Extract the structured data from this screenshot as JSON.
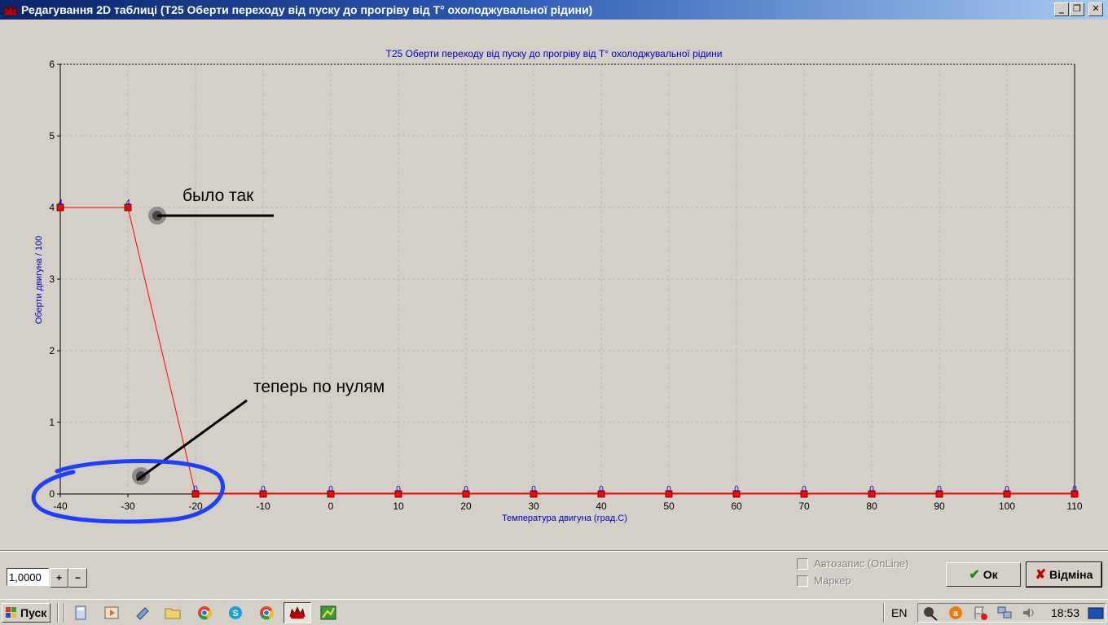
{
  "window": {
    "title": "Редагування 2D таблиці (T25 Оберти переходу від пуску до прогріву від T° охолоджувальної рідини)",
    "minimize_glyph": "_",
    "restore_glyph": "❐",
    "close_glyph": "✕"
  },
  "chart_data": {
    "type": "line",
    "title": "T25 Оберти переходу від пуску до прогріву від T° охолоджувальної рідини",
    "xlabel": "Температура двигуна (град.С)",
    "ylabel": "Оберти двигуна / 100",
    "x": [
      -40,
      -30,
      -20,
      -10,
      0,
      10,
      20,
      30,
      40,
      50,
      60,
      70,
      80,
      90,
      100,
      110
    ],
    "series": [
      {
        "name": "",
        "values": [
          4,
          4,
          0,
          0,
          0,
          0,
          0,
          0,
          0,
          0,
          0,
          0,
          0,
          0,
          0,
          0
        ],
        "point_labels": [
          "4",
          "4",
          "0",
          "0",
          "0",
          "0",
          "0",
          "0",
          "0",
          "0",
          "0",
          "0",
          "0",
          "0",
          "0",
          "0"
        ],
        "color": "#ff0000"
      }
    ],
    "xlim": [
      -40,
      110
    ],
    "ylim": [
      0,
      6
    ],
    "yticks": [
      0,
      1,
      2,
      3,
      4,
      5,
      6
    ],
    "xticks": [
      -40,
      -30,
      -20,
      -10,
      0,
      10,
      20,
      30,
      40,
      50,
      60,
      70,
      80,
      90,
      100,
      110
    ],
    "grid": true,
    "legend": "none"
  },
  "annotations": {
    "before_text": "было так",
    "after_text": "теперь по нулям",
    "circle_color": "#1f3fff"
  },
  "controls": {
    "step_value": "1,0000",
    "plus_label": "+",
    "minus_label": "−",
    "autosave_label": "Автозапис (OnLine)",
    "marker_label": "Маркер",
    "ok_label": "Ок",
    "cancel_label": "Відміна"
  },
  "taskbar": {
    "start_label": "Пуск",
    "language": "EN",
    "time": "18:53"
  },
  "colors": {
    "title_text": "#0000cc",
    "series": "#ff0000",
    "face": "#d4d0c8"
  }
}
